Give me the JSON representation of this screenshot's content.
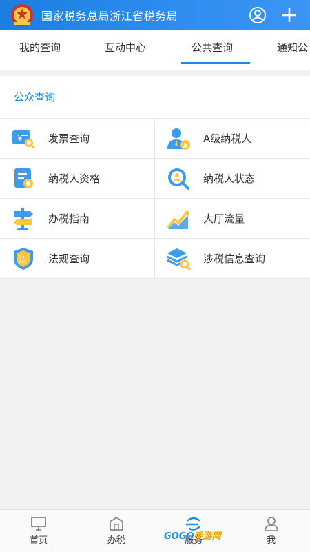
{
  "header": {
    "title": "国家税务总局浙江省税务局",
    "logo_icon": "tax-bureau-emblem",
    "user_icon": "user-circle-icon",
    "add_icon": "plus-icon"
  },
  "tabs": [
    {
      "label": "我的查询"
    },
    {
      "label": "互动中心"
    },
    {
      "label": "公共查询"
    },
    {
      "label": "通知公"
    }
  ],
  "active_tab": "公共查询",
  "section": {
    "title": "公众查询",
    "items": [
      {
        "label": "发票查询",
        "icon": "invoice-search-icon"
      },
      {
        "label": "A级纳税人",
        "icon": "a-level-taxpayer-icon"
      },
      {
        "label": "纳税人资格",
        "icon": "taxpayer-qualification-icon"
      },
      {
        "label": "纳税人状态",
        "icon": "taxpayer-status-icon"
      },
      {
        "label": "办税指南",
        "icon": "signpost-icon"
      },
      {
        "label": "大厅流量",
        "icon": "traffic-chart-icon"
      },
      {
        "label": "法规查询",
        "icon": "law-shield-icon"
      },
      {
        "label": "涉税信息查询",
        "icon": "layers-search-icon"
      }
    ]
  },
  "bottom_nav": [
    {
      "label": "首页",
      "icon": "monitor-icon"
    },
    {
      "label": "办税",
      "icon": "building-icon"
    },
    {
      "label": "服务",
      "icon": "service-icon"
    },
    {
      "label": "我",
      "icon": "person-icon"
    }
  ],
  "watermark": {
    "text_a": "GOGO",
    "text_b": "手游网"
  },
  "colors": {
    "brand": "#1a7fe0",
    "accent": "#1e88e5"
  }
}
